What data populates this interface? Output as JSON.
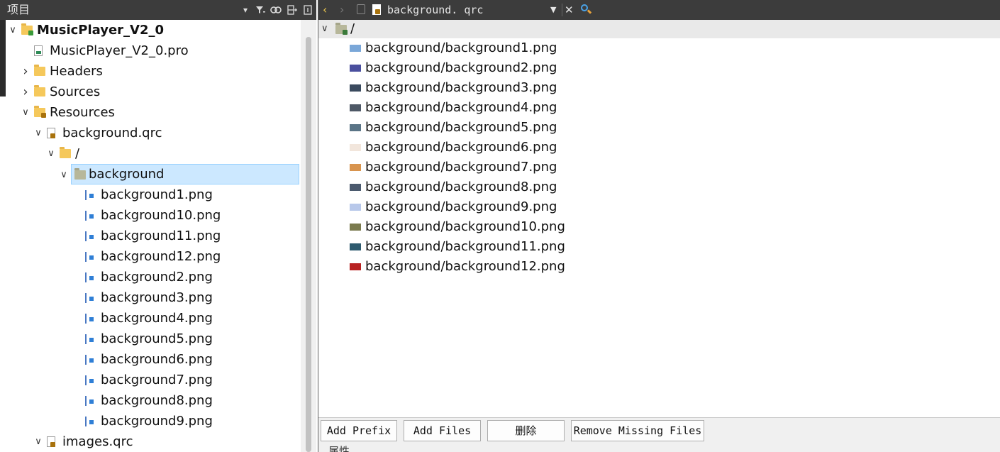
{
  "left_panel": {
    "title": "项目",
    "tree": [
      {
        "label": "MusicPlayer_V2_0",
        "depth": 0,
        "expand": "open",
        "icon": "project-folder-icon",
        "bold": true
      },
      {
        "label": "MusicPlayer_V2_0.pro",
        "depth": 1,
        "expand": "none",
        "icon": "pro-file-icon"
      },
      {
        "label": "Headers",
        "depth": 1,
        "expand": "closed",
        "icon": "headers-folder-icon"
      },
      {
        "label": "Sources",
        "depth": 1,
        "expand": "closed",
        "icon": "sources-folder-icon"
      },
      {
        "label": "Resources",
        "depth": 1,
        "expand": "open",
        "icon": "resources-folder-icon"
      },
      {
        "label": "background.qrc",
        "depth": 2,
        "expand": "open",
        "icon": "qrc-file-icon"
      },
      {
        "label": "/",
        "depth": 3,
        "expand": "open",
        "icon": "prefix-folder-icon"
      },
      {
        "label": "background",
        "depth": 4,
        "expand": "open",
        "icon": "folder-icon",
        "selected": true
      },
      {
        "label": "background1.png",
        "depth": 5,
        "expand": "none",
        "icon": "image-file-icon"
      },
      {
        "label": "background10.png",
        "depth": 5,
        "expand": "none",
        "icon": "image-file-icon"
      },
      {
        "label": "background11.png",
        "depth": 5,
        "expand": "none",
        "icon": "image-file-icon"
      },
      {
        "label": "background12.png",
        "depth": 5,
        "expand": "none",
        "icon": "image-file-icon"
      },
      {
        "label": "background2.png",
        "depth": 5,
        "expand": "none",
        "icon": "image-file-icon"
      },
      {
        "label": "background3.png",
        "depth": 5,
        "expand": "none",
        "icon": "image-file-icon"
      },
      {
        "label": "background4.png",
        "depth": 5,
        "expand": "none",
        "icon": "image-file-icon"
      },
      {
        "label": "background5.png",
        "depth": 5,
        "expand": "none",
        "icon": "image-file-icon"
      },
      {
        "label": "background6.png",
        "depth": 5,
        "expand": "none",
        "icon": "image-file-icon"
      },
      {
        "label": "background7.png",
        "depth": 5,
        "expand": "none",
        "icon": "image-file-icon"
      },
      {
        "label": "background8.png",
        "depth": 5,
        "expand": "none",
        "icon": "image-file-icon"
      },
      {
        "label": "background9.png",
        "depth": 5,
        "expand": "none",
        "icon": "image-file-icon"
      },
      {
        "label": "images.qrc",
        "depth": 2,
        "expand": "open",
        "icon": "qrc-file-icon"
      }
    ]
  },
  "editor": {
    "filename": "background. qrc",
    "root_prefix": "/",
    "resources": [
      {
        "path": "background/background1.png",
        "thumb": "#7aa7d8"
      },
      {
        "path": "background/background2.png",
        "thumb": "#4a4f9e"
      },
      {
        "path": "background/background3.png",
        "thumb": "#3a4a5e"
      },
      {
        "path": "background/background4.png",
        "thumb": "#4e5866"
      },
      {
        "path": "background/background5.png",
        "thumb": "#5a7486"
      },
      {
        "path": "background/background6.png",
        "thumb": "#f2e6dc"
      },
      {
        "path": "background/background7.png",
        "thumb": "#d8944e"
      },
      {
        "path": "background/background8.png",
        "thumb": "#4b5a6e"
      },
      {
        "path": "background/background9.png",
        "thumb": "#b8c8ea"
      },
      {
        "path": "background/background10.png",
        "thumb": "#7a7a4e"
      },
      {
        "path": "background/background11.png",
        "thumb": "#2e5a6e"
      },
      {
        "path": "background/background12.png",
        "thumb": "#b82222"
      }
    ],
    "buttons": {
      "add_prefix": "Add Prefix",
      "add_files": "Add Files",
      "delete": "删除",
      "remove_missing": "Remove Missing Files"
    },
    "properties_label": "属性"
  },
  "colors": {
    "header_bg": "#3c3c3c",
    "selection_bg": "#cce8ff",
    "back_arrow": "#e7c34c"
  }
}
